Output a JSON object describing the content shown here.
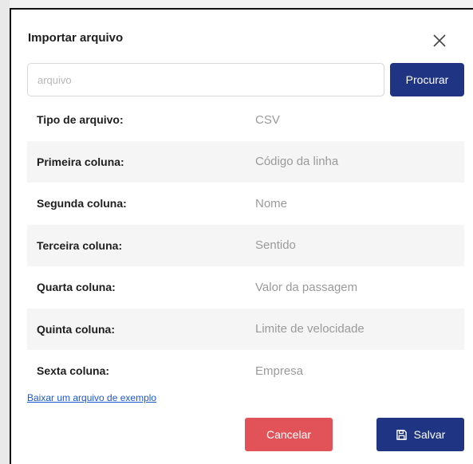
{
  "dialog": {
    "title": "Importar arquivo",
    "close_icon": "close-icon"
  },
  "file_input": {
    "placeholder": "arquivo",
    "value": ""
  },
  "browse_button": {
    "label": "Procurar"
  },
  "info_rows": [
    {
      "label": "Tipo de arquivo:",
      "value": "CSV"
    },
    {
      "label": "Primeira coluna:",
      "value": "Código da linha"
    },
    {
      "label": "Segunda coluna:",
      "value": "Nome"
    },
    {
      "label": "Terceira coluna:",
      "value": "Sentido"
    },
    {
      "label": "Quarta coluna:",
      "value": "Valor da passagem"
    },
    {
      "label": "Quinta coluna:",
      "value": "Limite de velocidade"
    },
    {
      "label": "Sexta coluna:",
      "value": "Empresa"
    }
  ],
  "example_link": {
    "label": "Baixar um arquivo de exemplo"
  },
  "actions": {
    "cancel_label": "Cancelar",
    "save_label": "Salvar",
    "save_icon": "floppy-disk-icon"
  },
  "colors": {
    "primary": "#1f3583",
    "danger": "#e15358",
    "link": "#1a57d6",
    "stripe": "#f5f5f5"
  }
}
